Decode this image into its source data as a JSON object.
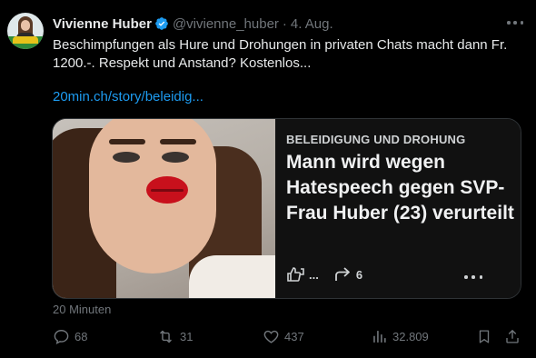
{
  "tweet": {
    "author_name": "Vivienne Huber",
    "handle": "@vivienne_huber",
    "separator": "·",
    "date": "4. Aug.",
    "text": "Beschimpfungen als Hure und Drohungen in privaten Chats macht dann Fr. 1200.-. Respekt und Anstand? Kostenlos...",
    "link": "20min.ch/story/beleidig..."
  },
  "card": {
    "kicker": "BELEIDIGUNG UND DROHUNG",
    "headline": "Mann wird wegen Hatespeech gegen SVP-Frau Huber (23) verurteilt",
    "reaction_count": "...",
    "share_count": "6"
  },
  "meta": {
    "timestamp": "20 Minuten"
  },
  "actions": {
    "replies": "68",
    "retweets": "31",
    "likes": "437",
    "views": "32.809"
  },
  "colors": {
    "background": "#000000",
    "link": "#1d9bf0",
    "verified": "#1d9bf0",
    "muted": "#71767b"
  }
}
